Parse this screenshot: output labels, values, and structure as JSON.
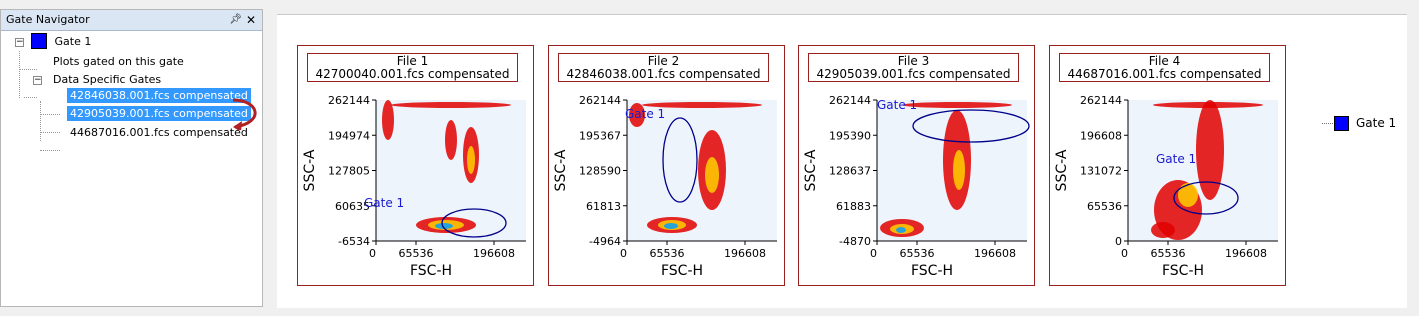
{
  "navigator": {
    "title": "Gate Navigator",
    "pin_icon": "pin-icon",
    "close_icon": "close-icon",
    "tree": {
      "root_label": "Gate 1",
      "root_color": "#0000ff",
      "plots_gated": "Plots gated on this gate",
      "data_specific": "Data Specific Gates",
      "files": [
        {
          "label": "42846038.001.fcs compensated",
          "selected": true
        },
        {
          "label": "42905039.001.fcs compensated",
          "selected": true
        },
        {
          "label": "44687016.001.fcs compensated",
          "selected": false
        }
      ]
    },
    "arrow_color": "#b22222"
  },
  "plots": [
    {
      "title": "File 1",
      "subtitle": "42700040.001.fcs compensated",
      "y_ticks": [
        "262144",
        "194974",
        "127805",
        "60635",
        "-6534"
      ],
      "x_ticks": [
        "0",
        "65536",
        "196608"
      ],
      "xlabel": "FSC-H",
      "ylabel": "SSC-A",
      "gate_label": "Gate 1"
    },
    {
      "title": "File 2",
      "subtitle": "42846038.001.fcs compensated",
      "y_ticks": [
        "262144",
        "195367",
        "128590",
        "61813",
        "-4964"
      ],
      "x_ticks": [
        "0",
        "65536",
        "196608"
      ],
      "xlabel": "FSC-H",
      "ylabel": "SSC-A",
      "gate_label": "Gate 1"
    },
    {
      "title": "File 3",
      "subtitle": "42905039.001.fcs compensated",
      "y_ticks": [
        "262144",
        "195390",
        "128637",
        "61883",
        "-4870"
      ],
      "x_ticks": [
        "0",
        "65536",
        "196608"
      ],
      "xlabel": "FSC-H",
      "ylabel": "SSC-A",
      "gate_label": "Gate 1"
    },
    {
      "title": "File 4",
      "subtitle": "44687016.001.fcs compensated",
      "y_ticks": [
        "262144",
        "196608",
        "131072",
        "65536",
        "0"
      ],
      "x_ticks": [
        "0",
        "65536",
        "196608"
      ],
      "xlabel": "FSC-H",
      "ylabel": "SSC-A",
      "gate_label": "Gate 1"
    }
  ],
  "legend": {
    "label": "Gate 1",
    "color": "#0000ff"
  },
  "colors": {
    "gate": "#00008b",
    "frame": "#9b2020",
    "plot_bg": "#eef4fb",
    "density_low": "#e00000",
    "density_mid": "#ffd000",
    "density_high": "#00a0ff"
  }
}
